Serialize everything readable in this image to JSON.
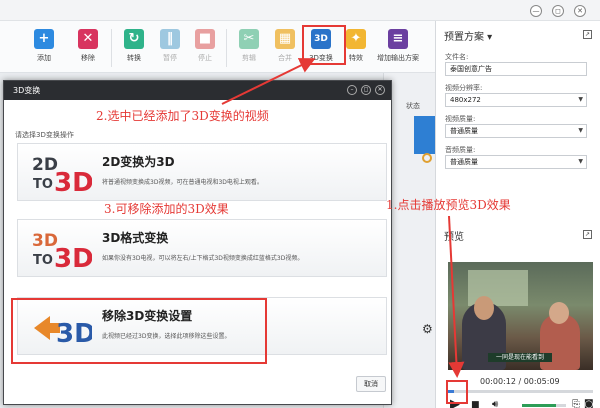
{
  "toolbar": {
    "items": [
      {
        "label": "添加",
        "icon": "plus-icon",
        "color": "#2d8ae0"
      },
      {
        "label": "移除",
        "icon": "remove-icon",
        "color": "#d8345f"
      },
      {
        "label": "转换",
        "icon": "convert-icon",
        "color": "#2fb38a"
      },
      {
        "label": "暂停",
        "icon": "pause-icon",
        "color": "#9ec8e0"
      },
      {
        "label": "停止",
        "icon": "stop-icon",
        "color": "#e8a0a0"
      },
      {
        "label": "剪辑",
        "icon": "cut-icon",
        "color": "#8fd0b4"
      },
      {
        "label": "合并",
        "icon": "merge-icon",
        "color": "#f0c060"
      },
      {
        "label": "3D变换",
        "icon": "3d-icon",
        "color": "#2a73c9"
      },
      {
        "label": "特效",
        "icon": "effects-icon",
        "color": "#f2b632"
      },
      {
        "label": "增加输出方案",
        "icon": "output-plan-icon",
        "color": "#6b3fa0"
      }
    ]
  },
  "window": {
    "controls": [
      "—",
      "◻",
      "✕"
    ]
  },
  "right_panel": {
    "preset_title": "预置方案",
    "filename_label": "文件名:",
    "filename_value": "泰国创意广告",
    "resolution_label": "视频分辨率:",
    "resolution_value": "480x272",
    "video_quality_label": "视频质量:",
    "video_quality_value": "普通质量",
    "audio_quality_label": "音频质量:",
    "audio_quality_value": "普通质量",
    "preview_title": "预览",
    "time": "00:00:12 / 00:05:09",
    "progress_fraction": 0.04,
    "volume_fraction": 0.78
  },
  "list": {
    "status_header": "状态"
  },
  "dialog": {
    "title": "3D变换",
    "prompt": "请选择3D变换操作",
    "options": [
      {
        "title": "2D变换为3D",
        "desc": "将普通视频变换成3D视频，可在普通电视和3D电视上观看。",
        "logo": [
          "2D",
          "TO",
          "3D"
        ]
      },
      {
        "title": "3D格式变换",
        "desc": "如果你没有3D电视，可以将左右/上下格式3D视频变换成红蓝格式3D视频。",
        "logo": [
          "3D",
          "TO",
          "3D"
        ]
      },
      {
        "title": "移除3D变换设置",
        "desc": "此视频已经过3D变换，选择此项移除这些设置。",
        "logo": [
          "3D"
        ]
      }
    ],
    "cancel": "取消"
  },
  "video": {
    "subtitle": "一同是现在能看到"
  },
  "annotations": {
    "a1": "1.点击播放预览3D效果",
    "a2": "2.选中已经添加了3D变换的视频",
    "a3": "3.可移除添加的3D效果"
  }
}
